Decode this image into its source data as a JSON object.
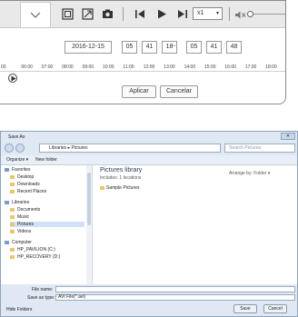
{
  "playback": {
    "date": "2016-12-15",
    "start_time": {
      "h": "05",
      "m": "41",
      "s": "18"
    },
    "end_time": {
      "h": "05",
      "m": "41",
      "s": "48"
    },
    "speed": "x1",
    "timeline_ticks": [
      "00",
      "06:00",
      "07:00",
      "08:00",
      "09:00",
      "10:00",
      "11:00",
      "12:00",
      "13:00",
      "14:00",
      "15:00",
      "16:00",
      "17:00",
      "18:00"
    ],
    "apply_label": "Aplicar",
    "cancel_label": "Cancelar"
  },
  "save_dialog": {
    "title": "Save As",
    "breadcrumb": [
      "Libraries",
      "Pictures"
    ],
    "search_placeholder": "Search Pictures",
    "organize_label": "Organize ▾",
    "new_folder_label": "New folder",
    "nav_items": [
      {
        "label": "Favorites",
        "group": true
      },
      {
        "label": "Desktop"
      },
      {
        "label": "Downloads"
      },
      {
        "label": "Recent Places"
      },
      {
        "label": "Libraries",
        "group": true
      },
      {
        "label": "Documents"
      },
      {
        "label": "Music"
      },
      {
        "label": "Pictures",
        "selected": true
      },
      {
        "label": "Videos"
      },
      {
        "label": "Computer",
        "group": true
      },
      {
        "label": "HP_PAVILION (C:)"
      },
      {
        "label": "HP_RECOVERY (D:)"
      }
    ],
    "library_title": "Pictures library",
    "library_subtitle": "Includes: 1 locations",
    "arrange_by": "Arrange by:  Folder ▾",
    "folder_items": [
      "Sample Pictures"
    ],
    "file_name_label": "File name:",
    "file_name_value": "",
    "save_type_label": "Save as type:",
    "save_type_value": "AVI File(*.avi)",
    "hide_folders_label": "Hide Folders",
    "save_label": "Save",
    "cancel_label": "Cancel"
  }
}
